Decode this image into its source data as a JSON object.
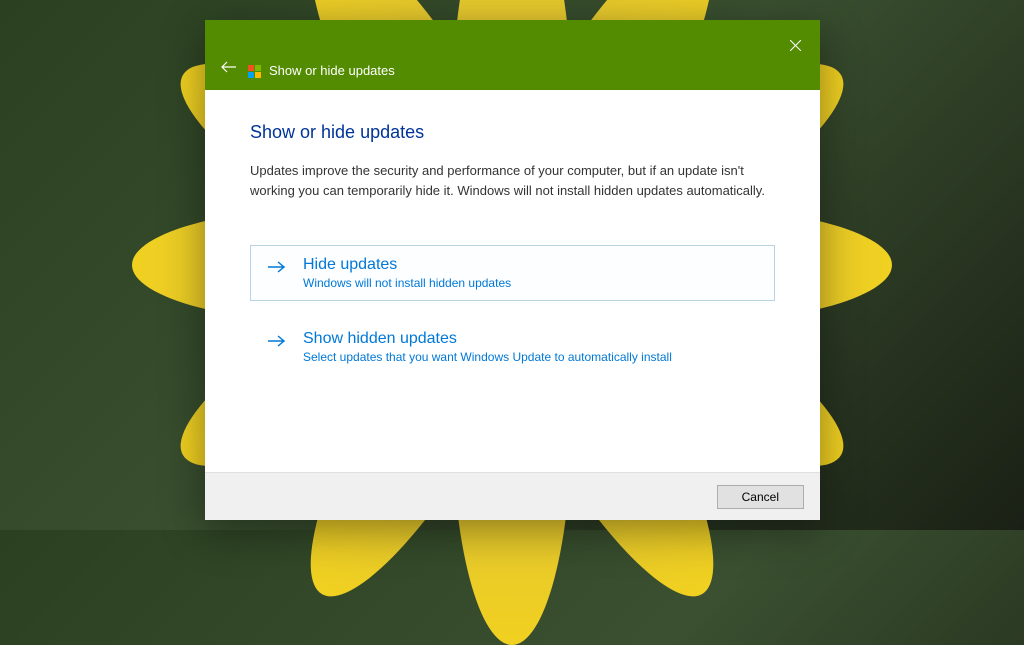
{
  "header": {
    "title": "Show or hide updates"
  },
  "page": {
    "title": "Show or hide updates",
    "description": "Updates improve the security and performance of your computer, but if an update isn't working you can temporarily hide it. Windows will not install hidden updates automatically."
  },
  "options": [
    {
      "title": "Hide updates",
      "subtitle": "Windows will not install hidden updates",
      "selected": true
    },
    {
      "title": "Show hidden updates",
      "subtitle": "Select updates that you want Windows Update to automatically install",
      "selected": false
    }
  ],
  "footer": {
    "cancel_label": "Cancel"
  }
}
